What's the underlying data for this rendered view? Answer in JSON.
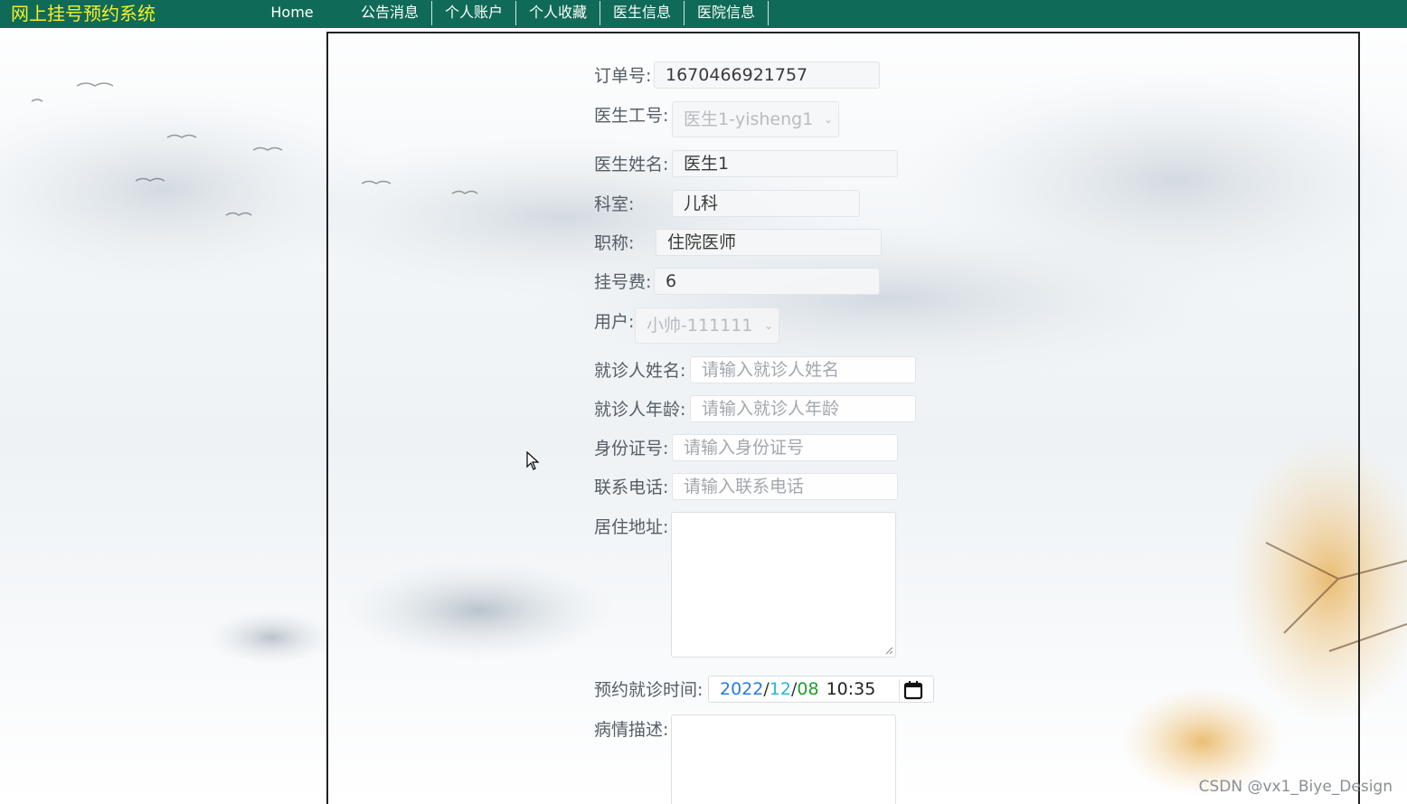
{
  "nav": {
    "brand": "网上挂号预约系统",
    "items": [
      "Home",
      "公告消息",
      "个人账户",
      "个人收藏",
      "医生信息",
      "医院信息"
    ]
  },
  "form": {
    "order_no": {
      "label": "订单号:",
      "value": "1670466921757"
    },
    "doctor_id": {
      "label": "医生工号:",
      "value": "医生1-yisheng1"
    },
    "doctor_name": {
      "label": "医生姓名:",
      "value": "医生1"
    },
    "department": {
      "label": "科室:",
      "value": "儿科"
    },
    "title": {
      "label": "职称:",
      "value": "住院医师"
    },
    "fee": {
      "label": "挂号费:",
      "value": "6"
    },
    "user": {
      "label": "用户:",
      "value": "小帅-111111"
    },
    "patient_name": {
      "label": "就诊人姓名:",
      "placeholder": "请输入就诊人姓名"
    },
    "patient_age": {
      "label": "就诊人年龄:",
      "placeholder": "请输入就诊人年龄"
    },
    "id_card": {
      "label": "身份证号:",
      "placeholder": "请输入身份证号"
    },
    "phone": {
      "label": "联系电话:",
      "placeholder": "请输入联系电话"
    },
    "address": {
      "label": "居住地址:"
    },
    "appointment_time": {
      "label": "预约就诊时间:",
      "year": "2022",
      "month": "12",
      "day": "08",
      "time": "10:35"
    },
    "description": {
      "label": "病情描述:"
    }
  },
  "watermark": "CSDN @vx1_Biye_Design",
  "colors": {
    "navbar": "#0f6b57",
    "brand": "#f5f02a",
    "year": "#2a7ae2",
    "month": "#29b6d8",
    "day": "#1f9e2f"
  }
}
